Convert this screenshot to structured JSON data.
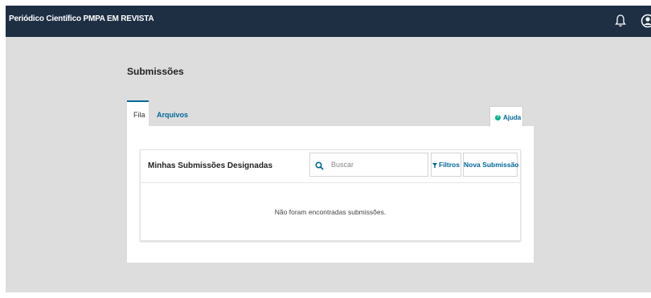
{
  "header": {
    "site_title": "Periódico Científico PMPA EM REVISTA",
    "icons": [
      "bell-icon",
      "user-icon"
    ]
  },
  "page": {
    "title": "Submissões"
  },
  "tabs": [
    {
      "label": "Fila",
      "active": true
    },
    {
      "label": "Arquivos",
      "active": false
    }
  ],
  "help": {
    "label": "Ajuda",
    "icon_glyph": "?"
  },
  "submissions_list": {
    "title": "Minhas Submissões Designadas",
    "search": {
      "placeholder": "Buscar",
      "value": ""
    },
    "filters_label": "Filtros",
    "new_label": "Nova Submissão",
    "empty_message": "Não foram encontradas submissões."
  },
  "colors": {
    "header_bg": "#1e2f44",
    "accent": "#006798",
    "help_green": "#00b28d",
    "page_bg": "#dddddd"
  }
}
